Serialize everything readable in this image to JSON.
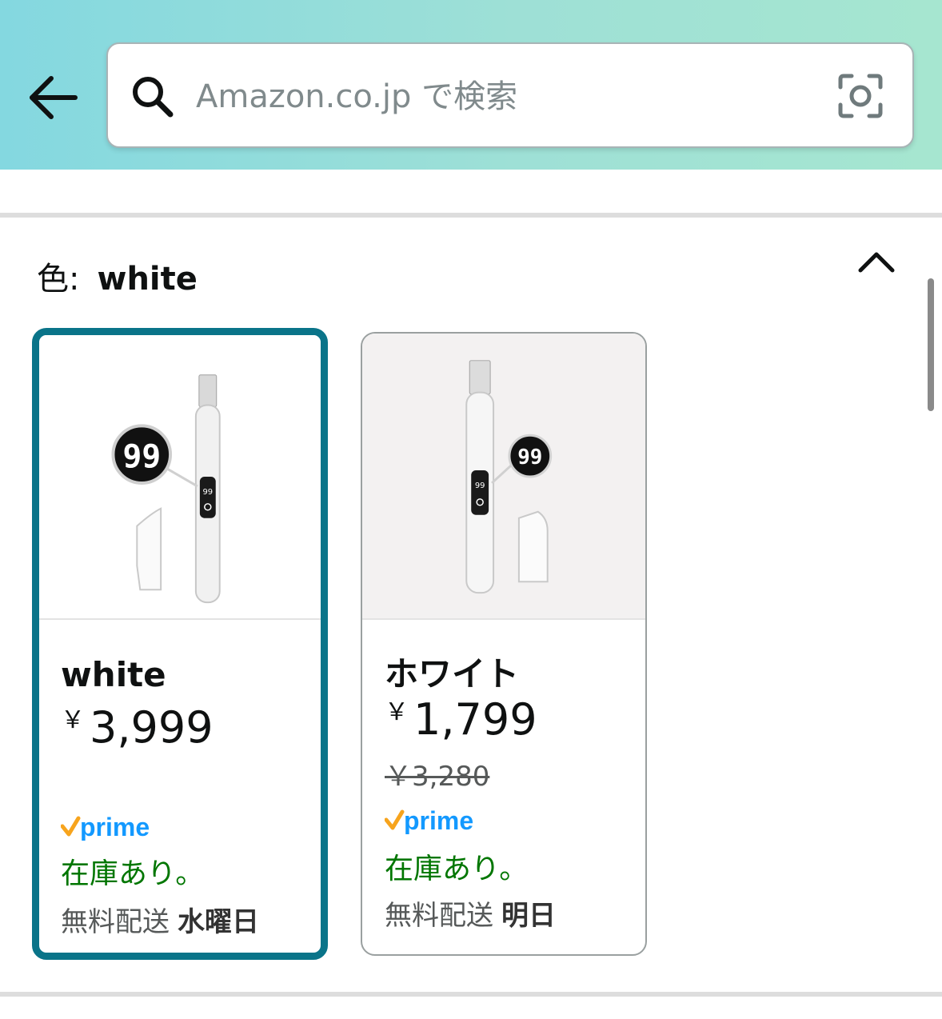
{
  "header": {
    "search_placeholder": "Amazon.co.jp で検索",
    "back_icon": "arrow-left-icon",
    "search_icon": "magnifier-icon",
    "camera_icon": "camera-lens-icon",
    "gradient_colors": [
      "#84d8e0",
      "#a6e6d0"
    ]
  },
  "variation": {
    "label": "色:",
    "selected_value": "white",
    "collapse_icon": "chevron-up-icon"
  },
  "options": [
    {
      "name": "white",
      "currency": "￥",
      "price": "3,999",
      "prime": "prime",
      "stock": "在庫あり。",
      "delivery_label": "無料配送",
      "delivery_day": "水曜日",
      "selected": true
    },
    {
      "name": "ホワイト",
      "currency": "￥",
      "price": "1,799",
      "list_price": "￥3,280",
      "prime": "prime",
      "stock": "在庫あり。",
      "delivery_label": "無料配送",
      "delivery_day": "明日",
      "selected": false
    }
  ],
  "colors": {
    "selected_border": "#0a7489",
    "in_stock": "#007600",
    "prime_blue": "#1399ff",
    "prime_check": "#f7a41d"
  }
}
